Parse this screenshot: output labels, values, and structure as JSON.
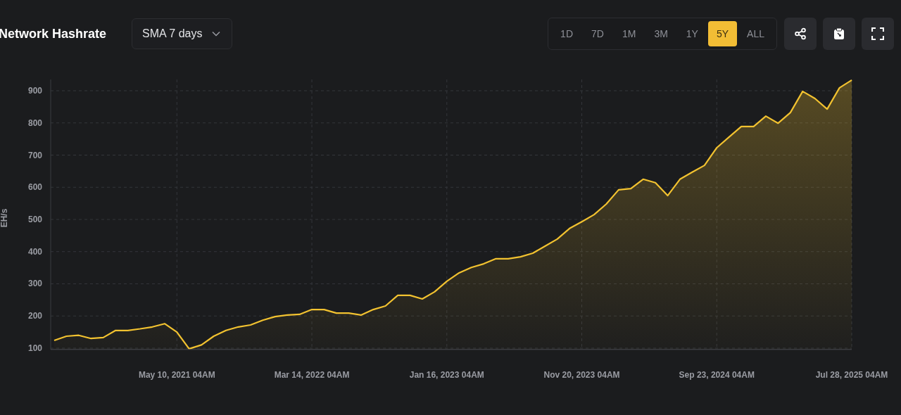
{
  "header": {
    "title": "Network Hashrate",
    "average_dropdown": {
      "value": "SMA 7 days"
    }
  },
  "ranges": [
    {
      "label": "1D",
      "selected": false
    },
    {
      "label": "7D",
      "selected": false
    },
    {
      "label": "1M",
      "selected": false
    },
    {
      "label": "3M",
      "selected": false
    },
    {
      "label": "1Y",
      "selected": false
    },
    {
      "label": "5Y",
      "selected": true
    },
    {
      "label": "ALL",
      "selected": false
    }
  ],
  "actions": [
    {
      "kind": "share"
    },
    {
      "kind": "clipboard"
    },
    {
      "kind": "fullscreen"
    }
  ],
  "chart": {
    "chart_data": {
      "type": "area",
      "ylabel": "EH/s",
      "categories": [
        null,
        null,
        null,
        null,
        null,
        null,
        null,
        null,
        null,
        null,
        "May 10, 2021 04AM",
        null,
        null,
        null,
        null,
        null,
        null,
        null,
        null,
        null,
        null,
        "Mar 14, 2022 04AM",
        null,
        null,
        null,
        null,
        null,
        null,
        null,
        null,
        null,
        null,
        "Jan 16, 2023 04AM",
        null,
        null,
        null,
        null,
        null,
        null,
        null,
        null,
        null,
        null,
        "Nov 20, 2023 04AM",
        null,
        null,
        null,
        null,
        null,
        null,
        null,
        null,
        null,
        null,
        "Sep 23, 2024 04AM",
        null,
        null,
        null,
        null,
        null,
        null,
        null,
        null,
        null,
        null,
        "Jul 28, 2025 04AM"
      ],
      "series": [
        {
          "color": "#f2c230",
          "values": [
            124,
            137,
            140,
            130,
            133,
            155,
            155,
            160,
            166,
            176,
            150,
            98,
            110,
            137,
            155,
            166,
            172,
            187,
            198,
            203,
            205,
            220,
            220,
            209,
            209,
            203,
            220,
            231,
            264,
            264,
            253,
            275,
            308,
            334,
            351,
            362,
            378,
            378,
            384,
            395,
            417,
            439,
            472,
            493,
            515,
            548,
            592,
            596,
            625,
            614,
            574,
            625,
            647,
            668,
            723,
            756,
            789,
            789,
            821,
            799,
            832,
            898,
            876,
            843,
            909,
            933
          ]
        }
      ],
      "grid": true,
      "ylim": [
        96,
        935
      ],
      "yticks": [
        100,
        200,
        300,
        400,
        500,
        600,
        700,
        800,
        900
      ]
    }
  }
}
